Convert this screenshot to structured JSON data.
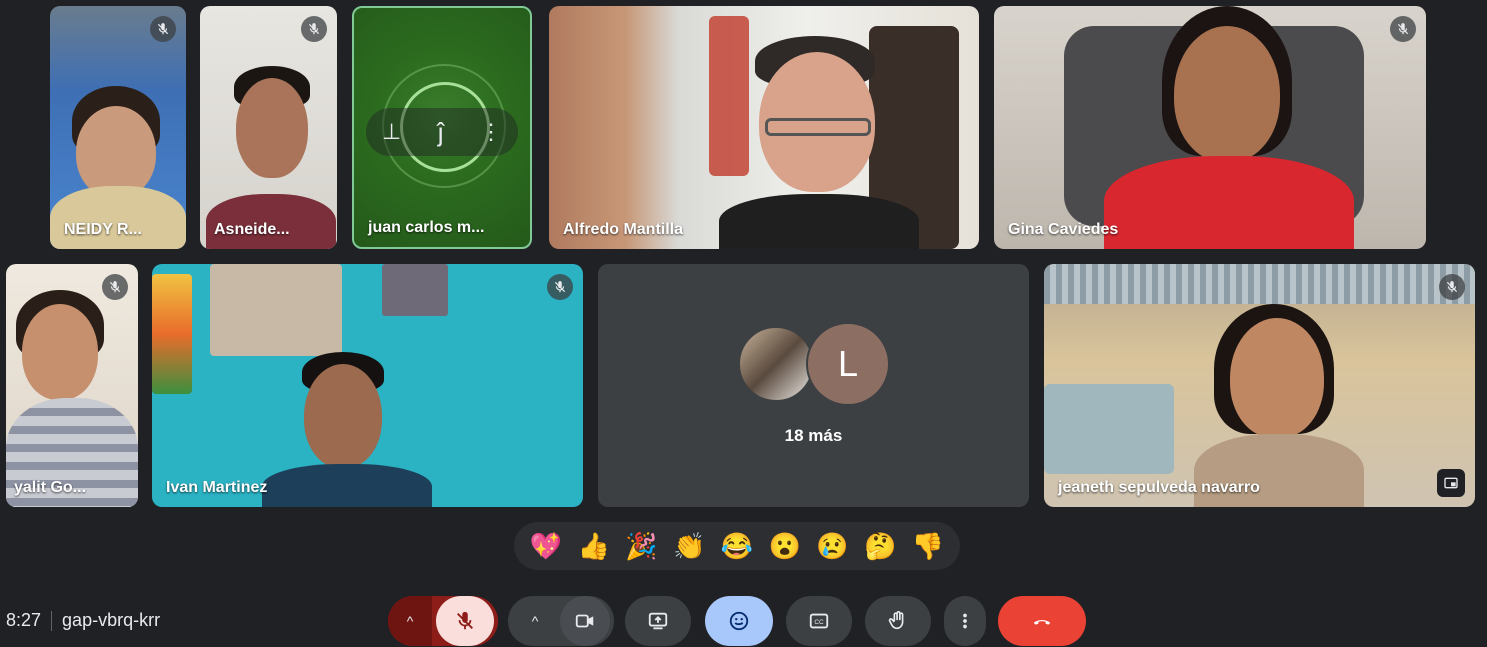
{
  "participants": [
    {
      "name": "NEIDY R...",
      "muted": true
    },
    {
      "name": "Asneide...",
      "muted": true
    },
    {
      "name": "juan carlos m...",
      "muted": false,
      "active": true
    },
    {
      "name": "Alfredo Mantilla",
      "muted": false
    },
    {
      "name": "Gina Caviedes",
      "muted": true
    },
    {
      "name": "yalit Go...",
      "muted": true
    },
    {
      "name": "Ivan Martinez",
      "muted": true
    },
    {
      "name": "jeaneth sepulveda navarro",
      "muted": true
    }
  ],
  "more_tile": {
    "avatar_letter": "L",
    "label": "18 más",
    "avatar_color": "#8d6e63"
  },
  "reactions": [
    "💖",
    "👍",
    "🎉",
    "👏",
    "😂",
    "😮",
    "😢",
    "🤔",
    "👎"
  ],
  "meeting": {
    "time": "8:27",
    "code": "gap-vbrq-krr"
  },
  "controls": {
    "mic": {
      "icon": "mic-off-icon",
      "state": "off",
      "color": "#f28b82",
      "bg": "#8c1d18"
    },
    "camera": {
      "icon": "camera-icon"
    },
    "present": {
      "icon": "present-screen-icon"
    },
    "emoji": {
      "icon": "emoji-icon",
      "active_bg": "#a8c7fa"
    },
    "captions": {
      "icon": "captions-icon"
    },
    "raise_hand": {
      "icon": "raise-hand-icon"
    },
    "more": {
      "icon": "more-vert-icon"
    },
    "leave": {
      "icon": "leave-call-icon",
      "bg": "#ea4335"
    }
  },
  "active_tile": {
    "pin_icon": "pin-icon",
    "speaking_icon": "speaking-indicator-icon",
    "more_icon": "more-vert-icon"
  }
}
